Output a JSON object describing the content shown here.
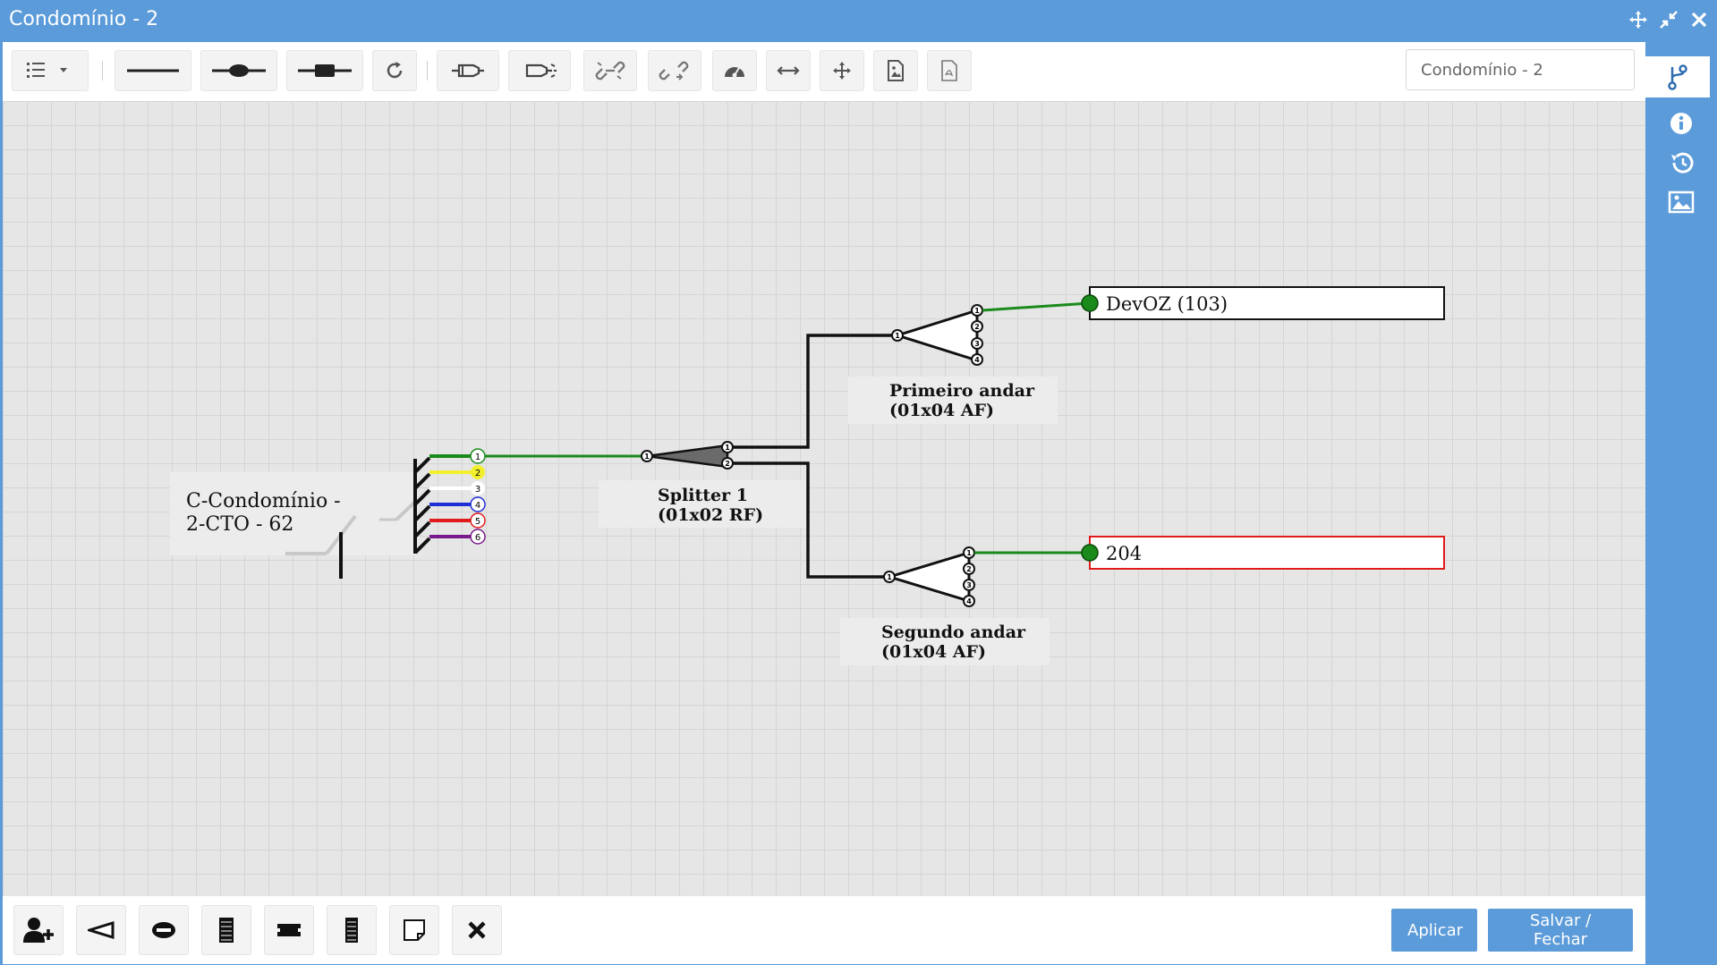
{
  "window": {
    "title": "Condomínio - 2"
  },
  "toolbar": {
    "name_value": "Condomínio - 2"
  },
  "diagram": {
    "cto_label_line1": "C-Condomínio -",
    "cto_label_line2": "2-CTO - 62",
    "fibers": [
      {
        "num": "1",
        "color": "#1a8a1a"
      },
      {
        "num": "2",
        "color": "#f2ef2e"
      },
      {
        "num": "3",
        "color": "#ffffff"
      },
      {
        "num": "4",
        "color": "#1f2fd6"
      },
      {
        "num": "5",
        "color": "#e01b1b"
      },
      {
        "num": "6",
        "color": "#7a1a8a"
      }
    ],
    "splitter1_line1": "Splitter 1",
    "splitter1_line2": "(01x02 RF)",
    "splitter2_line1": "Primeiro andar",
    "splitter2_line2": "(01x04 AF)",
    "splitter3_line1": "Segundo andar",
    "splitter3_line2": "(01x04 AF)",
    "client1_label": "DevOZ (103)",
    "client2_label": "204",
    "port_labels_2": [
      "1",
      "2"
    ],
    "port_labels_4": [
      "1",
      "2",
      "3",
      "4"
    ],
    "input_port": "1"
  },
  "actions": {
    "apply_label": "Aplicar",
    "save_close_label": "Salvar / Fechar"
  },
  "colors": {
    "accent": "#5b9bd9",
    "link_green": "#1a8a1a",
    "alert_red": "#e01b1b"
  }
}
